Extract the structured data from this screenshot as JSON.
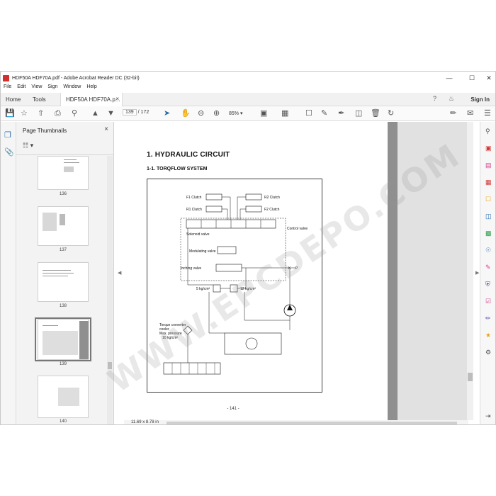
{
  "window": {
    "title": "HDF50A HDF70A.pdf - Adobe Acrobat Reader DC (32-bit)",
    "controls": {
      "minimize": "—",
      "maximize": "☐",
      "close": "✕"
    }
  },
  "menu": {
    "file": "File",
    "edit": "Edit",
    "view": "View",
    "sign": "Sign",
    "window": "Window",
    "help": "Help"
  },
  "tabs": {
    "home": "Home",
    "tools": "Tools",
    "doc": "HDF50A HDF70A.p...",
    "doc_close": "×",
    "sign_in": "Sign In"
  },
  "toolbar": {
    "page_current": "139",
    "page_sep": "/",
    "page_total": "172",
    "zoom": "85%",
    "zoom_caret": "▾"
  },
  "icons": {
    "save": "save-icon",
    "bookmark": "star-icon",
    "upload": "upload-icon",
    "print": "print-icon",
    "search": "search-icon",
    "prev": "page-up-icon",
    "next": "page-down-icon",
    "select": "cursor-icon",
    "hand": "hand-icon",
    "zoom_out": "zoom-out-icon",
    "zoom_in": "zoom-in-icon"
  },
  "thumbnails": {
    "title": "Page Thumbnails",
    "close": "×",
    "options": "☷ ▾",
    "pages": [
      "136",
      "137",
      "138",
      "139",
      "140"
    ],
    "selected": "139"
  },
  "document": {
    "heading": "1. HYDRAULIC CIRCUIT",
    "subheading": "1-1. TORQFLOW SYSTEM",
    "page_number": "- 141 -",
    "diagram": {
      "f1": "F1 Clutch",
      "r1": "R1 Clutch",
      "r2": "R2 Clutch",
      "f2": "F2 Clutch",
      "solenoid": "Solenoid valve",
      "control": "Control valve",
      "modulating": "Modulating valve",
      "inching": "Inching valve",
      "k": "K",
      "p": "P",
      "p5": "5 kg/cm²",
      "p12": "12 kg/cm²",
      "cooler": [
        "Torque converter",
        "cooler",
        "Max. pressure",
        "10 kg/cm²"
      ]
    },
    "page_size": "11.69 x 8.78 in"
  },
  "watermark": "WWW.EPCDEPO.COM",
  "colors": {
    "accent": "#2b6cb0",
    "acrobat_red": "#d32f2f"
  }
}
